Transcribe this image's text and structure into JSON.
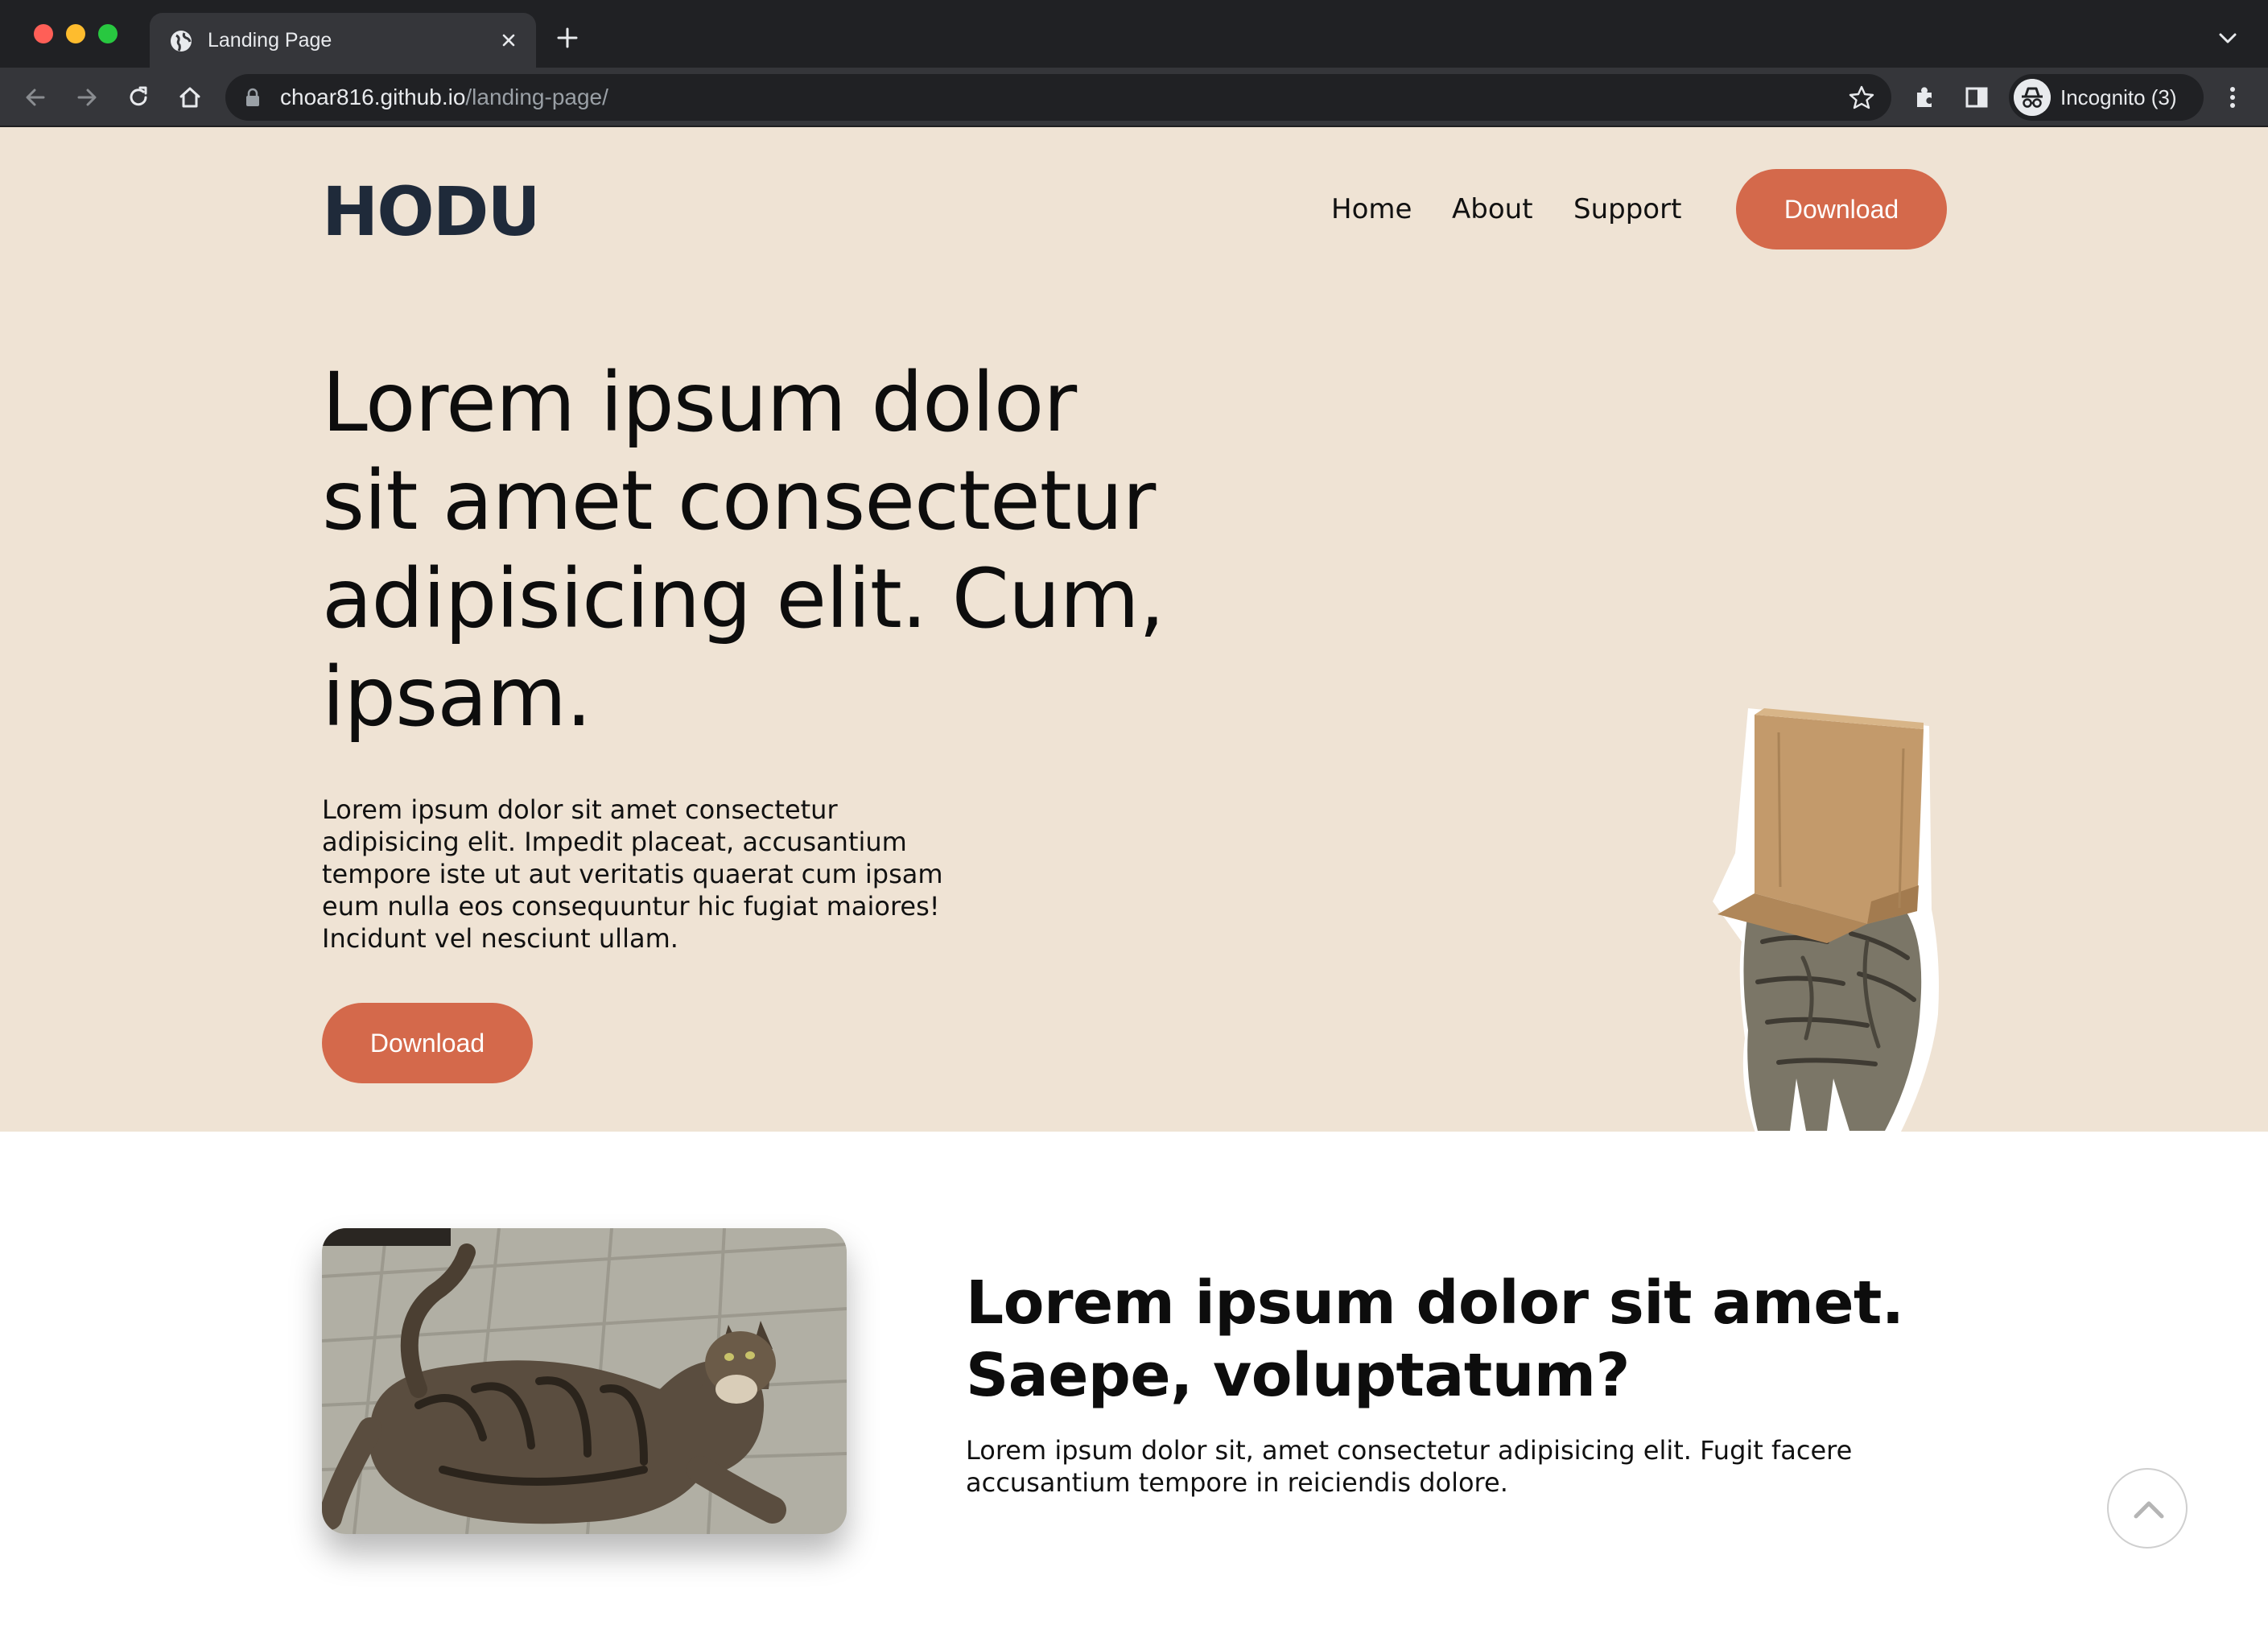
{
  "browser": {
    "tab_title": "Landing Page",
    "url_host": "choar816.github.io",
    "url_path": "/landing-page/",
    "profile_label": "Incognito (3)"
  },
  "header": {
    "logo_text": "HODU",
    "nav": [
      "Home",
      "About",
      "Support"
    ],
    "cta_label": "Download"
  },
  "hero": {
    "title": "Lorem ipsum dolor sit amet consectetur adipisicing elit. Cum, ipsam.",
    "description": "Lorem ipsum dolor sit amet consectetur adipisicing elit. Impedit placeat, accusantium tempore iste ut aut veritatis quaerat cum ipsam eum nulla eos consequuntur hic fugiat maiores! Incidunt vel nesciunt ullam.",
    "cta_label": "Download"
  },
  "feature": {
    "title": "Lorem ipsum dolor sit amet. Saepe, voluptatum?",
    "description": "Lorem ipsum dolor sit, amet consectetur adipisicing elit. Fugit facere accusantium tempore in reiciendis dolore."
  },
  "colors": {
    "hero_bg": "#efe3d4",
    "accent": "#d4694b",
    "logo": "#1f2a3a",
    "chrome_dark": "#202124",
    "chrome_toolbar": "#35363a"
  },
  "icons": [
    "globe-icon",
    "close-icon",
    "plus-icon",
    "chevron-down-icon",
    "back-arrow-icon",
    "forward-arrow-icon",
    "reload-icon",
    "home-icon",
    "lock-icon",
    "star-icon",
    "extensions-icon",
    "side-panel-icon",
    "incognito-icon",
    "kebab-menu-icon",
    "chevron-up-icon"
  ]
}
